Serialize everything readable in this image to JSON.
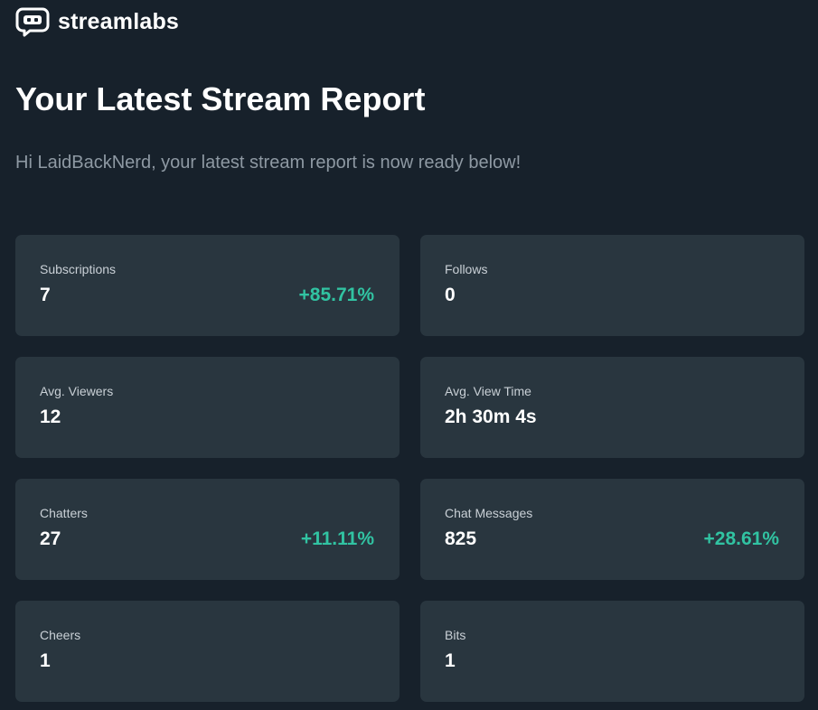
{
  "brand": {
    "name": "streamlabs",
    "icon": "streamlabs-logo-icon"
  },
  "header": {
    "title": "Your Latest Stream Report",
    "greeting": "Hi LaidBackNerd, your latest stream report is now ready below!"
  },
  "stats": {
    "subscriptions": {
      "label": "Subscriptions",
      "value": "7",
      "change": "+85.71%"
    },
    "follows": {
      "label": "Follows",
      "value": "0"
    },
    "avg_viewers": {
      "label": "Avg. Viewers",
      "value": "12"
    },
    "avg_view_time": {
      "label": "Avg. View Time",
      "value": "2h 30m 4s"
    },
    "chatters": {
      "label": "Chatters",
      "value": "27",
      "change": "+11.11%"
    },
    "chat_messages": {
      "label": "Chat Messages",
      "value": "825",
      "change": "+28.61%"
    },
    "cheers": {
      "label": "Cheers",
      "value": "1"
    },
    "bits": {
      "label": "Bits",
      "value": "1"
    }
  },
  "colors": {
    "background": "#17212b",
    "card": "#29363f",
    "positive_change": "#31c3a2",
    "muted_text": "#8e99a3"
  }
}
